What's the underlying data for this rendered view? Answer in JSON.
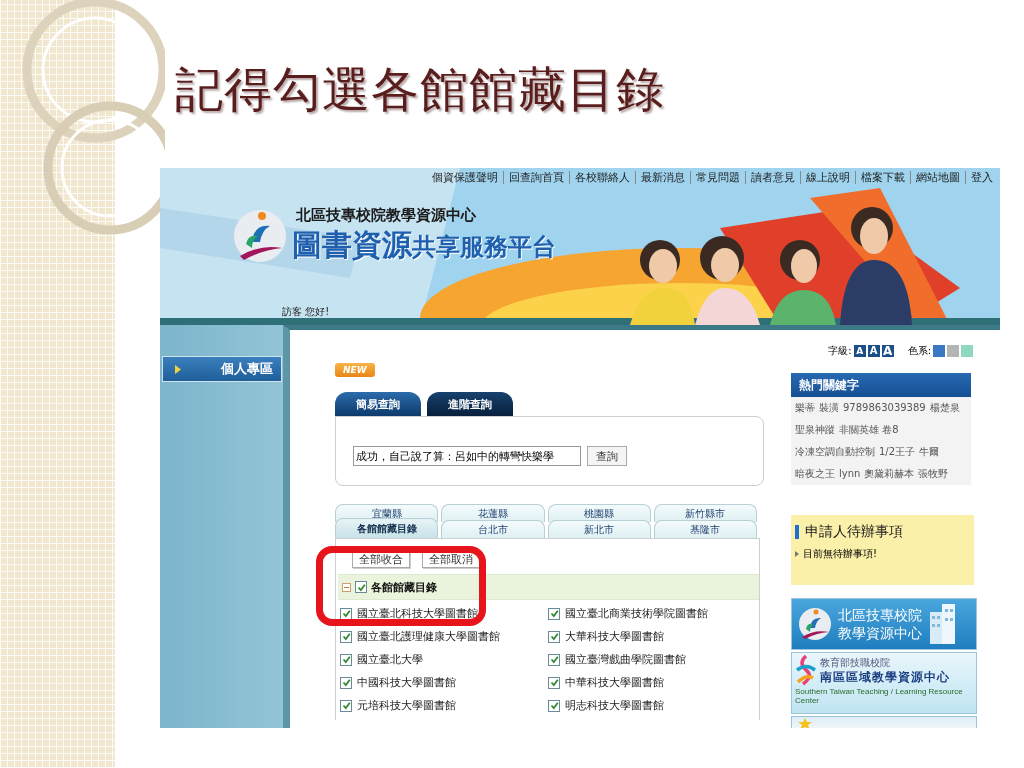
{
  "slide": {
    "title": "記得勾選各館館藏目錄"
  },
  "top_links": [
    "個資保護聲明",
    "回查詢首頁",
    "各校聯絡人",
    "最新消息",
    "常見問題",
    "讀者意見",
    "線上說明",
    "檔案下載",
    "網站地圖",
    "登入"
  ],
  "banner": {
    "subtitle": "北區技專校院教學資源中心",
    "title_main": "圖書資源",
    "title_rest": "共享服務平台",
    "greeting": "訪客 您好!"
  },
  "sidebar": {
    "items": [
      "個人專區"
    ]
  },
  "news": {
    "badge": "NEW"
  },
  "search": {
    "tabs": [
      {
        "label": "簡易查詢",
        "selected": true
      },
      {
        "label": "進階查詢",
        "selected": false
      }
    ],
    "value": "成功，自己說了算：呂如中的轉彎快樂學",
    "button": "查詢"
  },
  "font_size": {
    "label": "字級:",
    "options": [
      "A",
      "A",
      "A"
    ]
  },
  "color_scheme": {
    "label": "色系:",
    "swatches": [
      {
        "color": "#3b78c4"
      },
      {
        "color": "#b4b4b4"
      },
      {
        "color": "#8fd8c0"
      }
    ]
  },
  "hot_keywords": {
    "title": "熱門關鍵字",
    "lines": [
      {
        "keywords": [
          "樂蒂",
          "裝潢",
          "9789863039389",
          "楊楚泉"
        ]
      },
      {
        "keywords": [
          "聖泉神蹤",
          "非關英雄 卷8"
        ]
      },
      {
        "keywords": [
          "冷凍空調自動控制",
          "1/2王子",
          "牛爾"
        ]
      },
      {
        "keywords": [
          "暗夜之王",
          "lynn",
          "奧黛莉赫本",
          "張牧野"
        ]
      }
    ]
  },
  "region_tabs": {
    "rows": [
      [
        {
          "label": "宜蘭縣",
          "selected": false
        },
        {
          "label": "花蓮縣",
          "selected": false
        },
        {
          "label": "桃園縣",
          "selected": false
        },
        {
          "label": "新竹縣市",
          "selected": false
        }
      ],
      [
        {
          "label": "各館館藏目錄",
          "selected": true
        },
        {
          "label": "台北市",
          "selected": false
        },
        {
          "label": "新北市",
          "selected": false
        },
        {
          "label": "基隆市",
          "selected": false
        }
      ]
    ]
  },
  "tree": {
    "buttons": [
      "全部收合",
      "全部取消"
    ],
    "root": {
      "label": "各館館藏目錄",
      "expanded": true,
      "checked": true,
      "children": [
        {
          "label": "國立臺北科技大學圖書館",
          "checked": true
        },
        {
          "label": "國立臺北商業技術學院圖書館",
          "checked": true
        },
        {
          "label": "國立臺北護理健康大學圖書館",
          "checked": true
        },
        {
          "label": "大華科技大學圖書館",
          "checked": true
        },
        {
          "label": "國立臺北大學",
          "checked": true
        },
        {
          "label": "國立臺灣戲曲學院圖書館",
          "checked": true
        },
        {
          "label": "中國科技大學圖書館",
          "checked": true
        },
        {
          "label": "中華科技大學圖書館",
          "checked": true
        },
        {
          "label": "元培科技大學圖書館",
          "checked": true
        },
        {
          "label": "明志科技大學圖書館",
          "checked": true
        }
      ]
    }
  },
  "todo": {
    "title": "申請人待辦事項",
    "items": [
      "目前無待辦事項!"
    ]
  },
  "promo_banners": [
    {
      "kind": "north",
      "lines": [
        "北區技專校院",
        "教學資源中心"
      ]
    },
    {
      "kind": "south",
      "caption": "教育部技職校院",
      "title": "南區區域教學資源中心",
      "english": "Southern Taiwan Teaching / Learning Resource Center"
    },
    {
      "kind": "partial"
    }
  ]
}
